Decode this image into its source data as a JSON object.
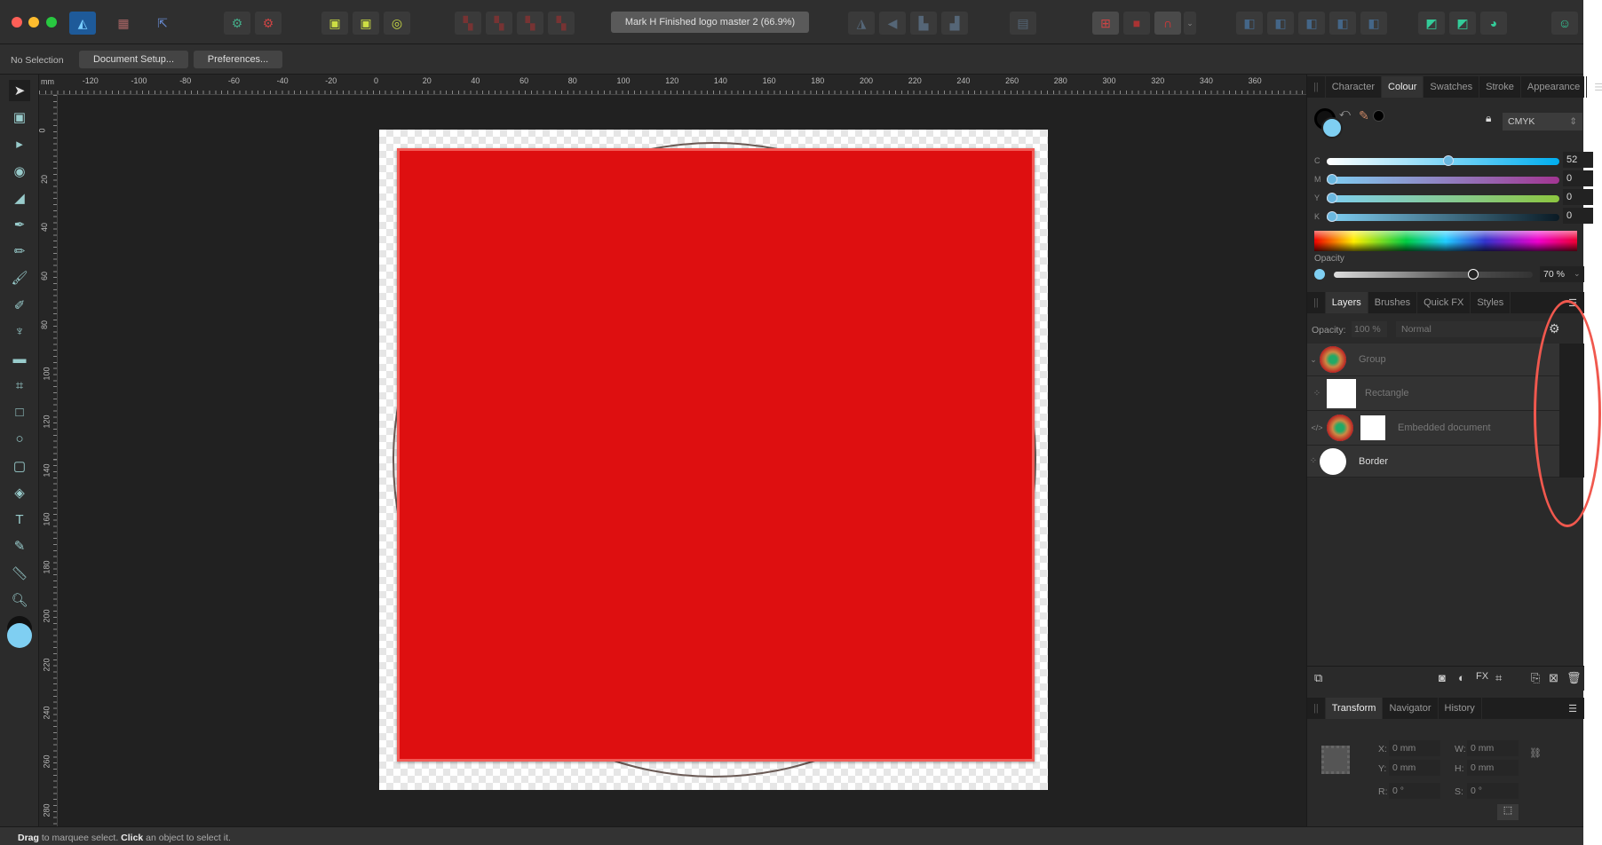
{
  "window": {
    "title": "Mark H Finished logo master 2 (66.9%)"
  },
  "context_bar": {
    "selection": "No Selection",
    "document_setup": "Document Setup...",
    "preferences": "Preferences..."
  },
  "ruler": {
    "unit": "mm",
    "h_ticks": [
      "-120",
      "-100",
      "-80",
      "-60",
      "-40",
      "-20",
      "0",
      "20",
      "40",
      "60",
      "80",
      "100",
      "120",
      "140",
      "160",
      "180",
      "200",
      "220",
      "240",
      "260",
      "280",
      "300",
      "320",
      "340",
      "360"
    ],
    "v_ticks": [
      "0",
      "20",
      "40",
      "60",
      "80",
      "100",
      "120",
      "140",
      "160",
      "180",
      "200",
      "220",
      "240",
      "260",
      "280"
    ]
  },
  "toolbar": {
    "tools": [
      "move-tool",
      "artboard-tool",
      "node-tool",
      "contour-tool",
      "corner-tool",
      "pen-tool",
      "pencil-tool",
      "vector-brush-tool",
      "fill-tool",
      "transparency-tool",
      "place-image-tool",
      "crop-tool",
      "rectangle-tool",
      "ellipse-tool",
      "rounded-rectangle-tool",
      "shape-builder-tool",
      "text-tool",
      "color-picker-tool",
      "measure-tool",
      "zoom-tool"
    ]
  },
  "colour_panel": {
    "tabs": [
      "Character",
      "Colour",
      "Swatches",
      "Stroke",
      "Appearance"
    ],
    "active_tab": "Colour",
    "model": "CMYK",
    "channels": [
      {
        "label": "C",
        "value": "52"
      },
      {
        "label": "M",
        "value": "0"
      },
      {
        "label": "Y",
        "value": "0"
      },
      {
        "label": "K",
        "value": "0"
      }
    ],
    "opacity_label": "Opacity",
    "opacity": "70 %",
    "fill_color": "#7fcff2"
  },
  "layers_panel": {
    "tabs": [
      "Layers",
      "Brushes",
      "Quick FX",
      "Styles"
    ],
    "active_tab": "Layers",
    "opacity_label": "Opacity:",
    "opacity": "100 %",
    "blend_mode": "Normal",
    "layers": [
      {
        "name": "Group"
      },
      {
        "name": "Rectangle"
      },
      {
        "name": "Embedded document"
      },
      {
        "name": "Border"
      }
    ]
  },
  "transform_panel": {
    "tabs": [
      "Transform",
      "Navigator",
      "History"
    ],
    "active_tab": "Transform",
    "fields": [
      {
        "label": "X:",
        "value": "0 mm"
      },
      {
        "label": "W:",
        "value": "0 mm"
      },
      {
        "label": "Y:",
        "value": "0 mm"
      },
      {
        "label": "H:",
        "value": "0 mm"
      },
      {
        "label": "R:",
        "value": "0 °"
      },
      {
        "label": "S:",
        "value": "0 °"
      }
    ]
  },
  "status": {
    "drag": "Drag",
    "drag_text": " to marquee select. ",
    "click": "Click",
    "click_text": " an object to select it."
  },
  "colors": {
    "document_red": "#de0f10",
    "annotation": "#f0584e"
  }
}
